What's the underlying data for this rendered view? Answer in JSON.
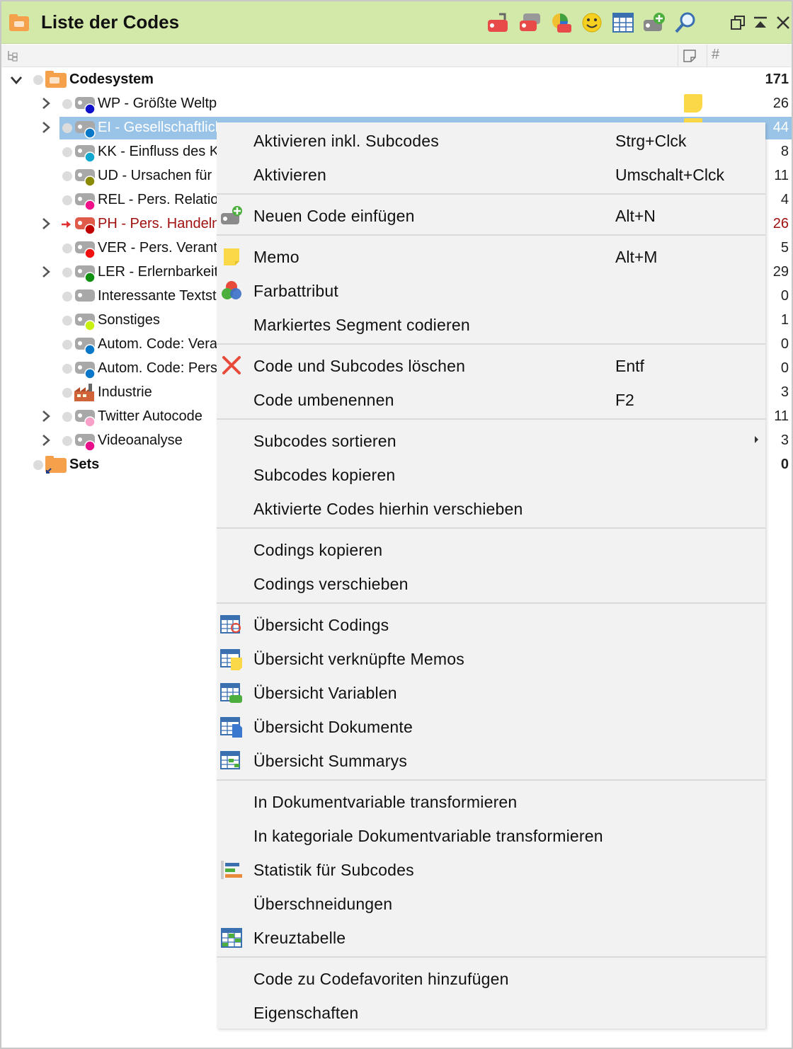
{
  "window": {
    "title": "Liste der Codes",
    "toolbar_icons": [
      "code-return-icon",
      "code-gray-icon",
      "color-wheel-icon",
      "smiley-icon",
      "grid-icon",
      "add-code-icon",
      "search-icon"
    ],
    "window_controls": [
      "restore-icon",
      "collapse-icon",
      "close-icon"
    ],
    "column_headers": {
      "memo": "memo-icon",
      "count": "#"
    }
  },
  "tree": {
    "root": {
      "label": "Codesystem",
      "count": "171"
    },
    "items": [
      {
        "label": "WP - Größte Weltprobleme",
        "count": "26",
        "dot": "#1010c8",
        "expand": true,
        "memo": true
      },
      {
        "label": "EI - Gesellschaftliches Engagement",
        "count": "44",
        "dot": "#0a78c8",
        "expand": true,
        "memo": true,
        "selected": true
      },
      {
        "label": "KK - Einfluss des Klimawandels",
        "count": "8",
        "dot": "#10a8d0",
        "expand": false
      },
      {
        "label": "UD - Ursachen für Klimawandel",
        "count": "11",
        "dot": "#8a8a00",
        "expand": false
      },
      {
        "label": "REL - Pers. Relationen",
        "count": "4",
        "dot": "#f0108a",
        "expand": false
      },
      {
        "label": "PH - Pers. Handeln",
        "count": "26",
        "dot": "#c00000",
        "expand": true,
        "red": true
      },
      {
        "label": "VER - Pers. Verantwortung",
        "count": "5",
        "dot": "#f01010",
        "expand": false
      },
      {
        "label": "LER - Erlernbarkeit",
        "count": "29",
        "dot": "#109010",
        "expand": true
      },
      {
        "label": "Interessante Textstellen",
        "count": "0",
        "dot": "",
        "expand": false
      },
      {
        "label": "Sonstiges",
        "count": "1",
        "dot": "#c8f010",
        "expand": false
      },
      {
        "label": "Autom. Code: Verantwortung",
        "count": "0",
        "dot": "#0a78c8",
        "expand": false
      },
      {
        "label": "Autom. Code: Person",
        "count": "0",
        "dot": "#0a78c8",
        "expand": false
      },
      {
        "label": "Industrie",
        "count": "3",
        "dot": "",
        "expand": false,
        "factory": true
      },
      {
        "label": "Twitter Autocode",
        "count": "11",
        "dot": "#f8a0c8",
        "expand": true
      },
      {
        "label": "Videoanalyse",
        "count": "3",
        "dot": "#e8108a",
        "expand": true
      }
    ],
    "sets": {
      "label": "Sets",
      "count": "0"
    }
  },
  "menu": {
    "items": [
      {
        "label": "Aktivieren inkl. Subcodes",
        "shortcut": "Strg+Clck"
      },
      {
        "label": "Aktivieren",
        "shortcut": "Umschalt+Clck"
      },
      {
        "label": "Neuen Code einfügen",
        "shortcut": "Alt+N",
        "icon": "add-code-icon"
      },
      {
        "label": "Memo",
        "shortcut": "Alt+M",
        "icon": "memo-icon"
      },
      {
        "label": "Farbattribut",
        "shortcut": "",
        "icon": "color-attribute-icon"
      },
      {
        "label": "Markiertes Segment codieren",
        "shortcut": ""
      },
      {
        "label": "Code und Subcodes löschen",
        "shortcut": "Entf",
        "icon": "delete-icon"
      },
      {
        "label": "Code umbenennen",
        "shortcut": "F2"
      },
      {
        "label": "Subcodes sortieren",
        "shortcut": "",
        "submenu": true
      },
      {
        "label": "Subcodes kopieren",
        "shortcut": ""
      },
      {
        "label": "Aktivierte Codes hierhin verschieben",
        "shortcut": ""
      },
      {
        "label": "Codings kopieren",
        "shortcut": ""
      },
      {
        "label": "Codings verschieben",
        "shortcut": ""
      },
      {
        "label": "Übersicht Codings",
        "shortcut": "",
        "icon": "overview-codings-icon"
      },
      {
        "label": "Übersicht verknüpfte Memos",
        "shortcut": "",
        "icon": "overview-memos-icon"
      },
      {
        "label": "Übersicht Variablen",
        "shortcut": "",
        "icon": "overview-variables-icon"
      },
      {
        "label": "Übersicht Dokumente",
        "shortcut": "",
        "icon": "overview-documents-icon"
      },
      {
        "label": "Übersicht Summarys",
        "shortcut": "",
        "icon": "overview-summaries-icon"
      },
      {
        "label": "In Dokumentvariable transformieren",
        "shortcut": ""
      },
      {
        "label": "In kategoriale Dokumentvariable transformieren",
        "shortcut": ""
      },
      {
        "label": "Statistik für Subcodes",
        "shortcut": "",
        "icon": "statistics-icon"
      },
      {
        "label": "Überschneidungen",
        "shortcut": ""
      },
      {
        "label": "Kreuztabelle",
        "shortcut": "",
        "icon": "crosstab-icon"
      },
      {
        "label": "Code zu Codefavoriten hinzufügen",
        "shortcut": ""
      },
      {
        "label": "Eigenschaften",
        "shortcut": ""
      }
    ]
  }
}
